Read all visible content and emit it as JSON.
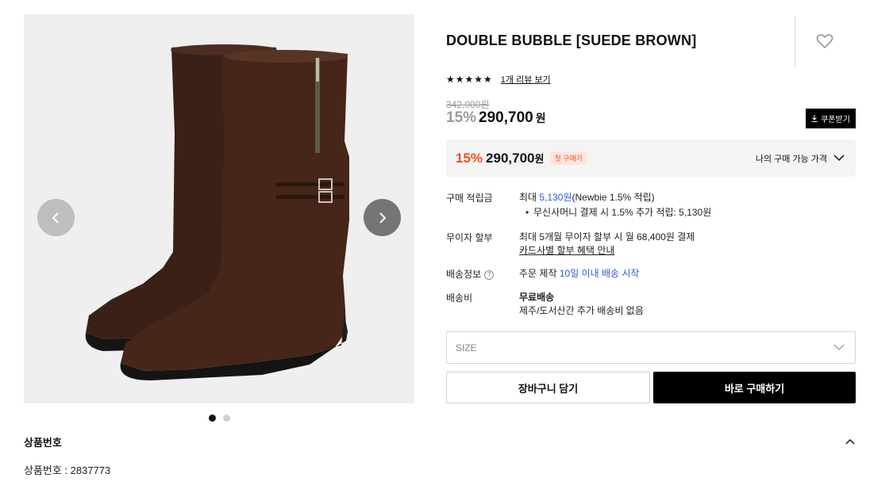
{
  "product": {
    "title": "DOUBLE BUBBLE [SUEDE BROWN]",
    "stars": "★★★★★",
    "review_link": "1개 리뷰 보기",
    "original_price": "342,000원",
    "discount_pct": "15%",
    "sale_price": "290,700",
    "won": "원",
    "coupon_label": "쿠폰받기"
  },
  "my_price": {
    "pct": "15%",
    "price": "290,700",
    "won": "원",
    "badge": "첫 구매가",
    "label": "나의 구매 가능 가격"
  },
  "points": {
    "label": "구매 적립금",
    "prefix": "최대 ",
    "amount": "5,130원",
    "suffix": "(Newbie 1.5% 적립)",
    "bullet": "무신사머니 결제 시 1.5% 추가 적립: 5,130원"
  },
  "installment": {
    "label": "무이자 할부",
    "text": "최대 5개월 무이자 할부 시 월 68,400원 결제",
    "link": "카드사별 할부 혜택 안내"
  },
  "shipping_info": {
    "label": "배송정보",
    "help": "?",
    "prefix": "주문 제작 ",
    "highlight": "10일 이내 배송 시작"
  },
  "shipping_fee": {
    "label": "배송비",
    "main": "무료배송",
    "sub": "제주/도서산간 추가 배송비 없음"
  },
  "size_select": {
    "placeholder": "SIZE"
  },
  "buttons": {
    "cart": "장바구니 담기",
    "buy": "바로 구매하기"
  },
  "gallery": {
    "dot_count": 2,
    "active_index": 0
  },
  "product_number": {
    "section_title": "상품번호",
    "value": "상품번호 : 2837773"
  },
  "colors": {
    "accent_orange": "#f0501e",
    "link_blue": "#2d5ad8",
    "boot_brown": "#3d2218"
  },
  "icons": [
    "chevron-left-icon",
    "chevron-right-icon",
    "heart-icon",
    "download-icon",
    "chevron-down-icon",
    "chevron-up-icon",
    "help-icon"
  ]
}
